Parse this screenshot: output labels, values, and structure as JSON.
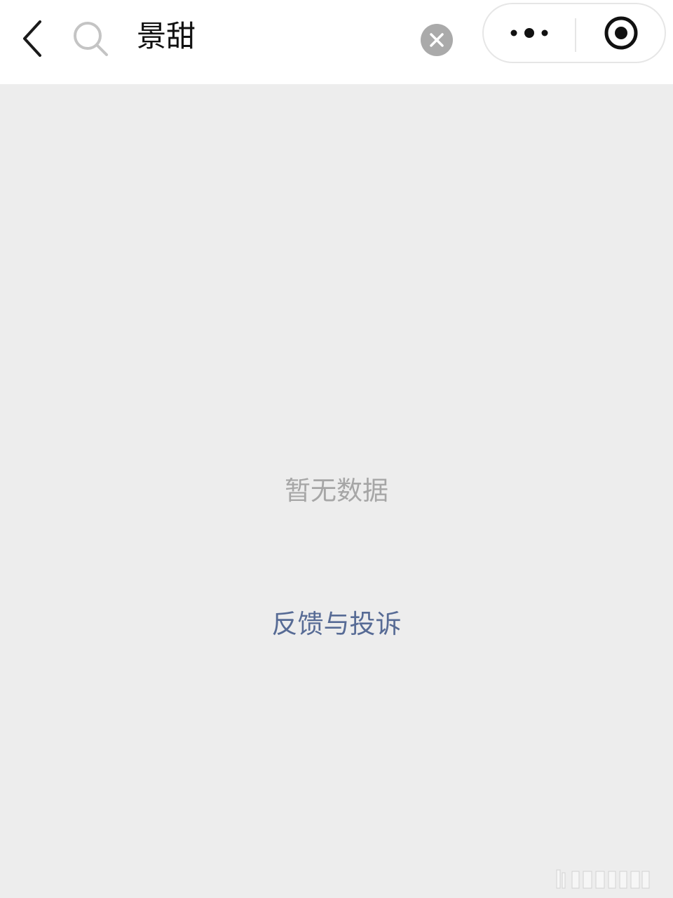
{
  "search": {
    "query": "景甜"
  },
  "result": {
    "empty_text": "暂无数据",
    "feedback_link": "反馈与投诉"
  },
  "icons": {
    "back": "chevron-left-icon",
    "search": "search-icon",
    "clear": "clear-icon",
    "more": "more-dots-icon",
    "close_miniprogram": "target-circle-icon"
  },
  "colors": {
    "topbar_bg": "#ffffff",
    "page_bg": "#ededed",
    "link": "#576b95",
    "empty_text": "#a6a6a6",
    "clear_button": "#aaaaaa"
  }
}
